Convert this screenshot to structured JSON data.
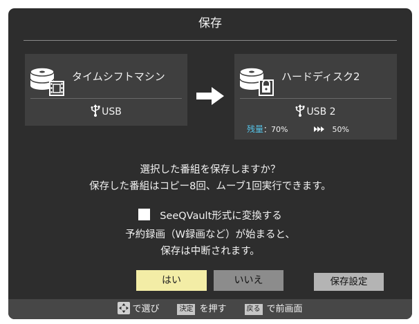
{
  "dialog": {
    "title": "保存",
    "source": {
      "device_icon": "disc-stack-film-icon",
      "name": "タイムシフトマシン",
      "connection": "USB"
    },
    "destination": {
      "device_icon": "disc-stack-lock-icon",
      "name": "ハードディスク2",
      "connection": "USB 2",
      "remaining_label": "残量",
      "remaining_separator": "：",
      "remaining_now": "70%",
      "remaining_after": "50%"
    },
    "transfer_icon": "right-arrow-icon",
    "confirm_line1": "選択した番組を保存しますか？",
    "confirm_line2": "保存した番組はコピー8回、ムーブ1回実行できます。",
    "seeqvault": {
      "checked": false,
      "label": "SeeQVault形式に変換する"
    },
    "warning_line1": "予約録画（W録画など）が始まると、",
    "warning_line2": "保存は中断されます。",
    "buttons": {
      "yes": "はい",
      "no": "いいえ",
      "settings": "保存設定"
    },
    "selected_button": "yes"
  },
  "footer": {
    "select_icon": "dpad-icon",
    "select_text": "で選び",
    "enter_key": "決定",
    "enter_text": "を押す",
    "back_key": "戻る",
    "back_text": "で前画面"
  },
  "colors": {
    "dialog_bg": "#2d2d2d",
    "panel_bg": "#3f3f3f",
    "accent_cyan": "#55c3e8",
    "yes_button": "#f3eda6",
    "no_button": "#8c8c8c",
    "settings_button": "#b4b4b4",
    "footer_bg": "#474747"
  }
}
